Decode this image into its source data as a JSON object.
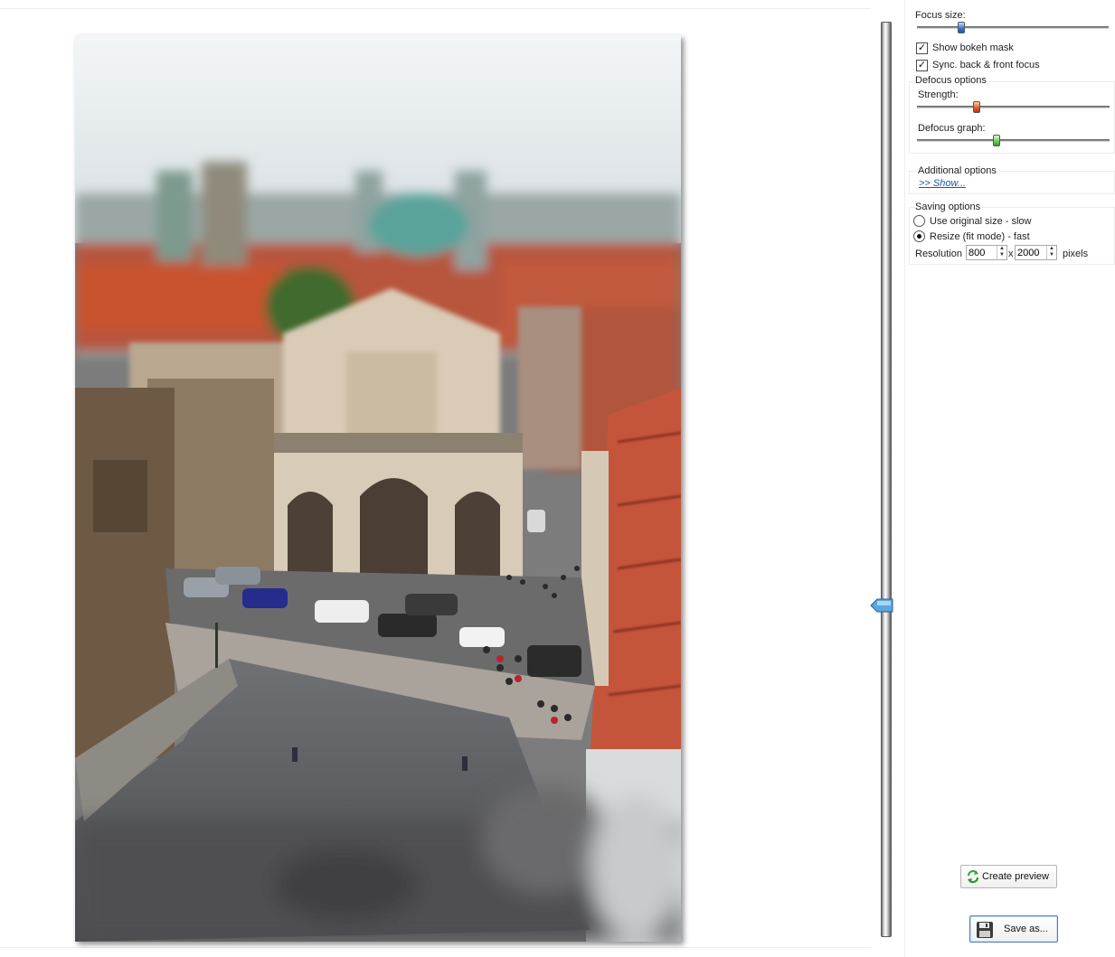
{
  "focus": {
    "focus_size_label": "Focus size:",
    "focus_size_value": 0.22,
    "show_bokeh_mask_label": "Show bokeh mask",
    "show_bokeh_mask_checked": true,
    "sync_focus_label": "Sync. back & front focus",
    "sync_focus_checked": true,
    "vertical_focus_position": 0.64
  },
  "defocus": {
    "group_label": "Defocus options",
    "strength_label": "Strength:",
    "strength_value": 0.3,
    "graph_label": "Defocus graph:",
    "graph_value": 0.41
  },
  "additional": {
    "group_label": "Additional options",
    "show_link": ">> Show..."
  },
  "saving": {
    "group_label": "Saving options",
    "original_label": "Use original size - slow",
    "resize_label": "Resize (fit mode) - fast",
    "selected": "resize",
    "resolution_label": "Resolution",
    "width": "800",
    "separator": "x",
    "height": "2000",
    "unit": "pixels"
  },
  "buttons": {
    "create_preview": "Create preview",
    "save_as": "Save as..."
  },
  "colors": {
    "thumb_focus": "#3f78d8",
    "thumb_strength": "#e0602c",
    "thumb_graph": "#6ccf55",
    "link": "#1a55b0"
  },
  "icons": [
    "refresh-icon",
    "floppy-disk-icon",
    "check-icon",
    "slider-arrow-icon"
  ]
}
